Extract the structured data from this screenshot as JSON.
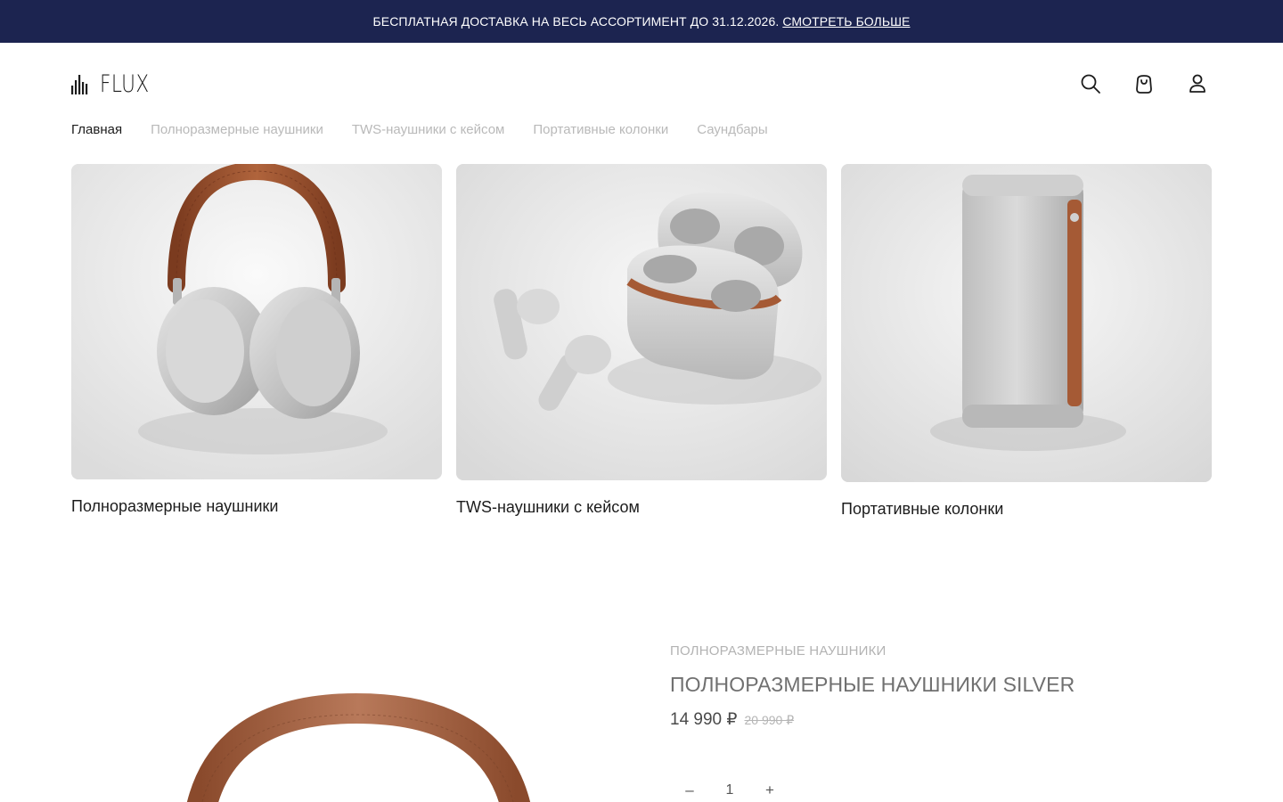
{
  "promo": {
    "text": "БЕСПЛАТНАЯ ДОСТАВКА НА ВЕСЬ АССОРТИМЕНТ ДО 31.12.2026.",
    "link": "СМОТРЕТЬ БОЛЬШЕ"
  },
  "brand": {
    "name": "FLUX"
  },
  "header_icons": [
    "search-icon",
    "shopping-bag-icon",
    "user-icon"
  ],
  "nav": [
    {
      "label": "Главная",
      "active": true
    },
    {
      "label": "Полноразмерные наушники",
      "active": false
    },
    {
      "label": "TWS-наушники с кейсом",
      "active": false
    },
    {
      "label": "Портативные колонки",
      "active": false
    },
    {
      "label": "Саундбары",
      "active": false
    }
  ],
  "categories": [
    {
      "label": "Полноразмерные наушники"
    },
    {
      "label": "TWS-наушники с кейсом"
    },
    {
      "label": "Портативные колонки"
    }
  ],
  "product": {
    "category": "ПОЛНОРАЗМЕРНЫЕ НАУШНИКИ",
    "title": "ПОЛНОРАЗМЕРНЫЕ НАУШНИКИ SILVER",
    "price": "14 990 ₽",
    "old_price": "20 990 ₽",
    "quantity": "1",
    "minus": "–",
    "plus": "+"
  },
  "colors": {
    "promo_bg": "#1c2450",
    "leather": "#a55a35",
    "silver": "#c9c9c9"
  }
}
